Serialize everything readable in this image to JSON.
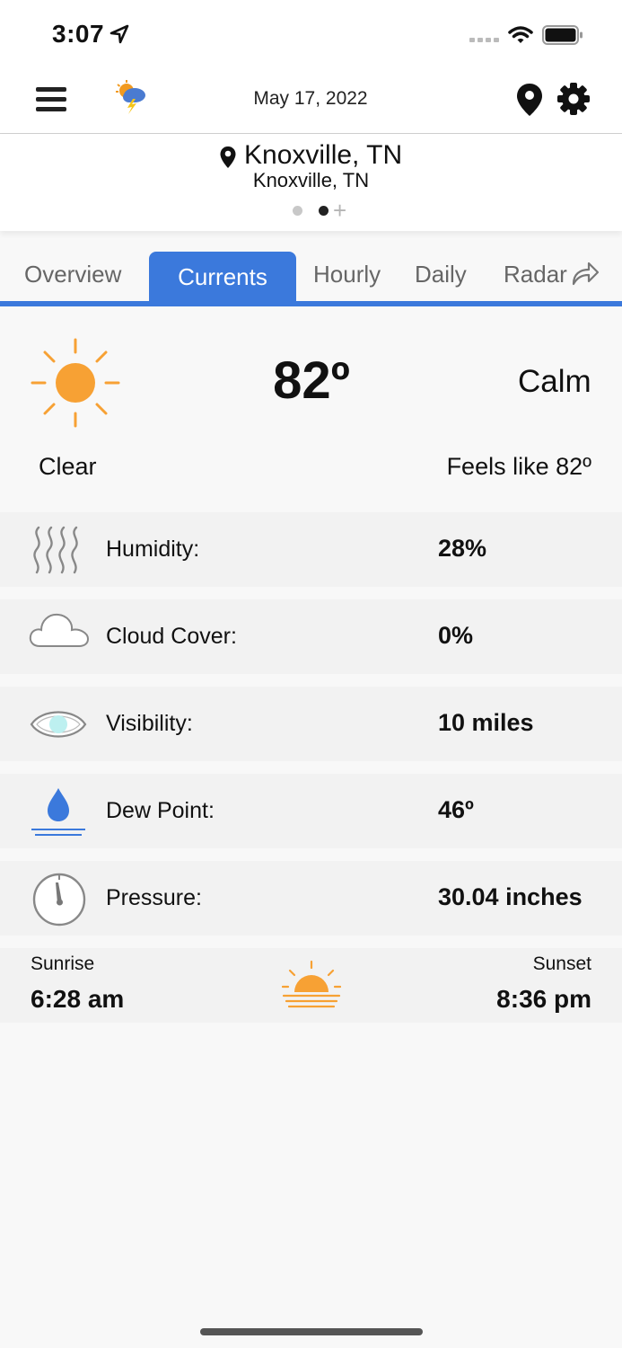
{
  "status_bar": {
    "time": "3:07"
  },
  "nav": {
    "date": "May 17, 2022"
  },
  "location": {
    "name": "Knoxville, TN",
    "subtitle": "Knoxville, TN",
    "add_symbol": "+"
  },
  "tabs": [
    {
      "label": "Overview",
      "active": false
    },
    {
      "label": "Currents",
      "active": true
    },
    {
      "label": "Hourly",
      "active": false
    },
    {
      "label": "Daily",
      "active": false
    },
    {
      "label": "Radar",
      "active": false
    }
  ],
  "current": {
    "temperature": "82º",
    "wind": "Calm",
    "condition": "Clear",
    "feels_like": "Feels like 82º"
  },
  "details": [
    {
      "label": "Humidity:",
      "value": "28%",
      "icon": "humidity-icon"
    },
    {
      "label": "Cloud Cover:",
      "value": "0%",
      "icon": "cloud-icon"
    },
    {
      "label": "Visibility:",
      "value": "10 miles",
      "icon": "eye-icon"
    },
    {
      "label": "Dew Point:",
      "value": "46º",
      "icon": "water-drop-icon"
    },
    {
      "label": "Pressure:",
      "value": "30.04 inches",
      "icon": "gauge-icon"
    }
  ],
  "sun": {
    "sunrise_label": "Sunrise",
    "sunrise_time": "6:28 am",
    "sunset_label": "Sunset",
    "sunset_time": "8:36 pm"
  },
  "colors": {
    "accent": "#3b79dc",
    "sun": "#f7a134",
    "row_bg": "#f2f2f2",
    "page_bg": "#f8f8f8"
  }
}
